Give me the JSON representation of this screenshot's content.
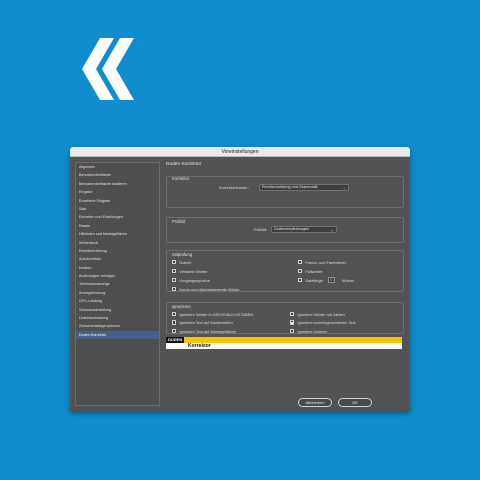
{
  "app": {
    "title": "Voreinstellungen"
  },
  "sidebar": {
    "items": [
      {
        "label": "Allgemein"
      },
      {
        "label": "Benutzeroberfläche"
      },
      {
        "label": "Benutzeroberfläche skalieren"
      },
      {
        "label": "Eingabe"
      },
      {
        "label": "Erweiterte Eingabe"
      },
      {
        "label": "Satz"
      },
      {
        "label": "Einheiten und Einteilungen"
      },
      {
        "label": "Raster"
      },
      {
        "label": "Hilfslinien und Montagefläche"
      },
      {
        "label": "Wörterbuch"
      },
      {
        "label": "Rechtschreibung"
      },
      {
        "label": "Autokorrektur"
      },
      {
        "label": "Notizen"
      },
      {
        "label": "Änderungen verfolgen"
      },
      {
        "label": "Textmodusanzeige"
      },
      {
        "label": "Anzeigeleistung"
      },
      {
        "label": "GPU-Leistung"
      },
      {
        "label": "Schwarzdarstellung"
      },
      {
        "label": "Dateihandhabung"
      },
      {
        "label": "Zwischenablageoptionen"
      },
      {
        "label": "Duden Korrektor",
        "active": true
      }
    ]
  },
  "panel": {
    "heading": "Duden Korrektor",
    "korrektur": {
      "title": "Korrektur",
      "label": "Korrekturfenster:",
      "value": "Rechtschreibung und Grammatik"
    },
    "pruefstil": {
      "title": "Prüfstil",
      "label": "Prüfstil:",
      "value": "Dudenempfehlungen"
    },
    "stilpruefung": {
      "title": "Stilprüfung",
      "left": [
        {
          "label": "Dialekt",
          "checked": false
        },
        {
          "label": "Veraltete Wörter",
          "checked": false
        },
        {
          "label": "Umgangssprache",
          "checked": false
        },
        {
          "label": "Derbe und diskriminierende Wörter",
          "checked": false
        }
      ],
      "right": [
        {
          "label": "Fremd- und Fachwörter",
          "checked": false
        },
        {
          "label": "Füllwörter",
          "checked": false
        }
      ],
      "satzlaenge": {
        "label": "Satzlänge:",
        "value": "0",
        "unit": "Wörter",
        "checked": false
      }
    },
    "ignorieren": {
      "title": "Ignorieren",
      "left": [
        {
          "label": "Ignoriere Wörter in GROSSBUCHSTABEN",
          "checked": false
        },
        {
          "label": "Ignoriere Text auf Musterseiten",
          "checked": false
        },
        {
          "label": "Ignoriere Text auf Montagefläche",
          "checked": false
        }
      ],
      "right": [
        {
          "label": "Ignoriere Wörter mit Zahlen",
          "checked": false
        },
        {
          "label": "Ignoriere schreibgeschützten Text",
          "checked": true
        },
        {
          "label": "Ignoriere Notizen",
          "checked": false
        }
      ]
    },
    "banner": {
      "logo": "DUDEN",
      "text": "Korrektor"
    }
  },
  "buttons": {
    "cancel": "Abbrechen",
    "ok": "OK"
  },
  "colors": {
    "background": "#0f8dcf",
    "dialog": "#535353",
    "accent": "#46608a",
    "duden_yellow": "#f8c300"
  }
}
